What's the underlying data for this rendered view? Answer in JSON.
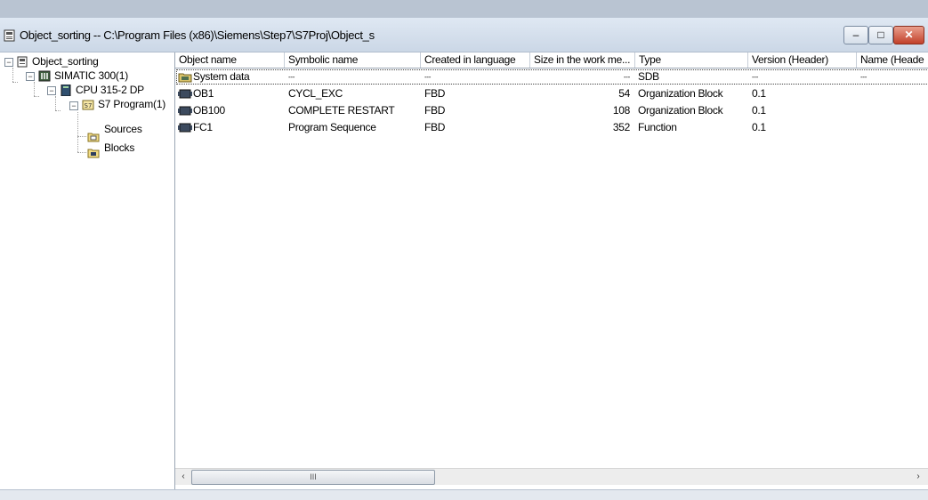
{
  "window": {
    "title": "Object_sorting -- C:\\Program Files (x86)\\Siemens\\Step7\\S7Proj\\Object_s",
    "controls": {
      "minimize": "–",
      "maximize": "□",
      "close": "✕"
    }
  },
  "tree": {
    "nodes": [
      {
        "label": "Object_sorting",
        "icon": "project-icon",
        "expander": "−"
      },
      {
        "label": "SIMATIC 300(1)",
        "icon": "station-icon",
        "expander": "−"
      },
      {
        "label": "CPU 315-2 DP",
        "icon": "cpu-icon",
        "expander": "−"
      },
      {
        "label": "S7 Program(1)",
        "icon": "program-icon",
        "expander": "−"
      },
      {
        "label": "Sources",
        "icon": "folder-sources-icon"
      },
      {
        "label": "Blocks",
        "icon": "folder-blocks-icon"
      }
    ]
  },
  "table": {
    "columns": [
      "Object name",
      "Symbolic name",
      "Created in language",
      "Size in the work me...",
      "Type",
      "Version (Header)",
      "Name (Heade"
    ],
    "rows": [
      {
        "name": "System data",
        "icon": "system-data-icon",
        "symbolic": "---",
        "language": "---",
        "size": "---",
        "type": "SDB",
        "version": "---",
        "header_name": "---"
      },
      {
        "name": "OB1",
        "icon": "block-icon",
        "symbolic": "CYCL_EXC",
        "language": "FBD",
        "size": "54",
        "type": "Organization Block",
        "version": "0.1",
        "header_name": ""
      },
      {
        "name": "OB100",
        "icon": "block-icon",
        "symbolic": "COMPLETE RESTART",
        "language": "FBD",
        "size": "108",
        "type": "Organization Block",
        "version": "0.1",
        "header_name": ""
      },
      {
        "name": "FC1",
        "icon": "block-icon",
        "symbolic": "Program Sequence",
        "language": "FBD",
        "size": "352",
        "type": "Function",
        "version": "0.1",
        "header_name": ""
      }
    ]
  },
  "scrollbar": {
    "left_arrow": "‹",
    "right_arrow": "›",
    "thumb_grip": "III"
  }
}
